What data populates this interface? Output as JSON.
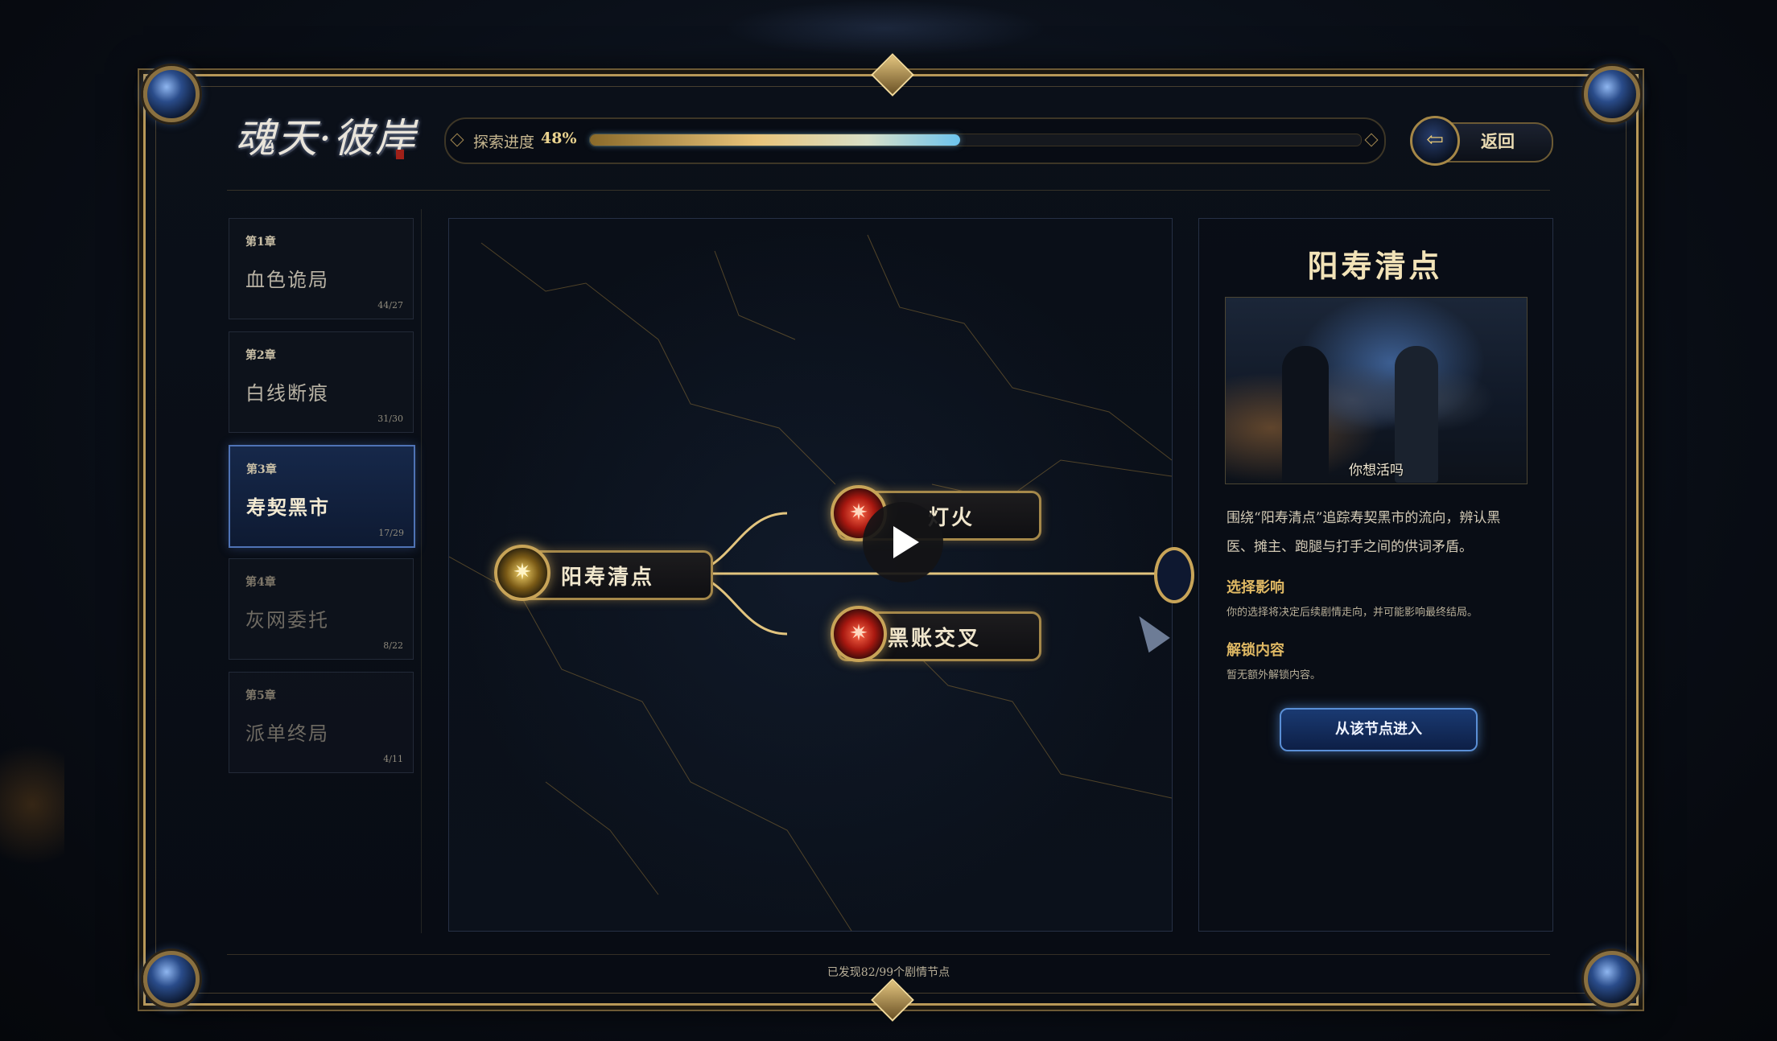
{
  "header": {
    "logo_text": "魂天·彼岸",
    "progress_label": "探索进度",
    "progress_value": "48%",
    "progress_fraction": 0.48,
    "back_label": "返回",
    "back_icon": "back-arrow-icon"
  },
  "chapters": [
    {
      "num": "第1章",
      "title": "血色诡局",
      "count": "44/27"
    },
    {
      "num": "第2章",
      "title": "白线断痕",
      "count": "31/30"
    },
    {
      "num": "第3章",
      "title": "寿契黑市",
      "count": "17/29"
    },
    {
      "num": "第4章",
      "title": "灰网委托",
      "count": "8/22"
    },
    {
      "num": "第5章",
      "title": "派单终局",
      "count": "4/11"
    }
  ],
  "map": {
    "nodes": [
      {
        "label": "阳寿清点",
        "icon": "gold-star-icon"
      },
      {
        "label": "灯火",
        "icon": "red-star-icon"
      },
      {
        "label": "黑账交叉",
        "icon": "red-star-icon"
      }
    ],
    "play_icon": "play-icon"
  },
  "detail": {
    "title": "阳寿清点",
    "scene_caption": "你想活吗",
    "description": "围绕“阳寿清点”追踪寿契黑市的流向，辨认黑医、摊主、跑腿与打手之间的供词矛盾。",
    "impact_title": "选择影响",
    "impact_text": "你的选择将决定后续剧情走向，并可能影响最终结局。",
    "unlock_title": "解锁内容",
    "unlock_text": "暂无额外解锁内容。",
    "enter_button": "从该节点进入"
  },
  "footer": {
    "text": "已发现82/99个剧情节点"
  },
  "colors": {
    "gold_accent": "#b89858",
    "active_blue": "#4f73b5",
    "progress_fill_end": "#6cc4ee"
  }
}
